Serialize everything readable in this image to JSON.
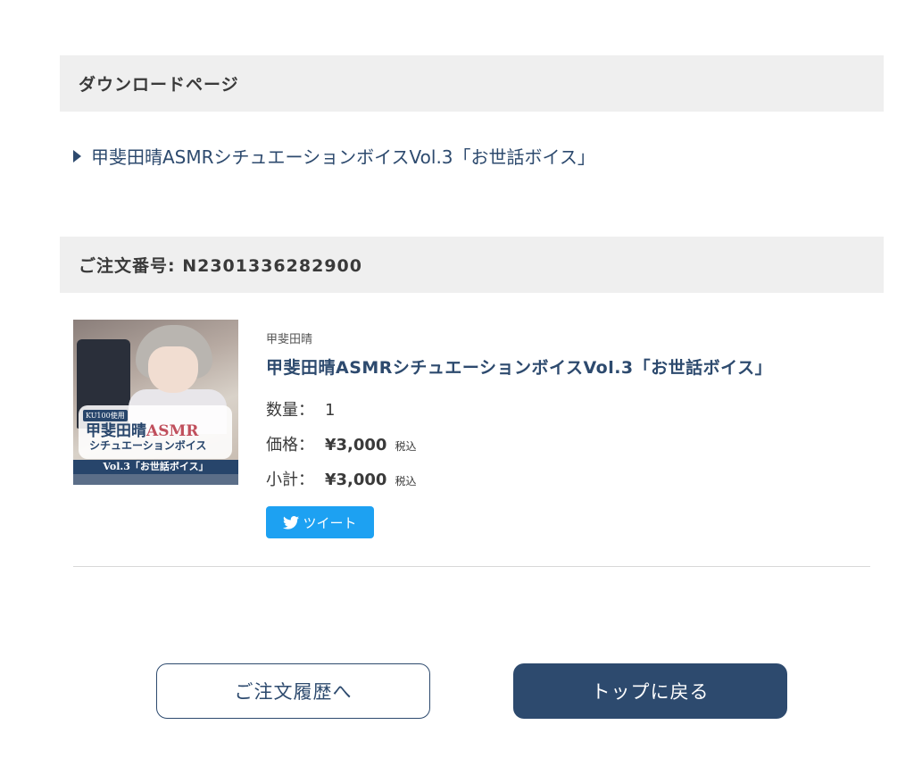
{
  "download_section": {
    "heading": "ダウンロードページ",
    "link_text": "甲斐田晴ASMRシチュエーションボイスVol.3「お世話ボイス」"
  },
  "order_section": {
    "label": "ご注文番号: N2301336282900"
  },
  "product": {
    "maker": "甲斐田晴",
    "title": "甲斐田晴ASMRシチュエーションボイスVol.3「お世話ボイス」",
    "quantity_label": "数量：",
    "quantity_value": "1",
    "price_label": "価格：",
    "price_value": "¥3,000",
    "subtotal_label": "小計：",
    "subtotal_value": "¥3,000",
    "tax_label": "税込",
    "image": {
      "badge": "KU100使用",
      "logo_main_part": "甲斐田晴",
      "logo_asmr": "ASMR",
      "logo_sub": "シチュエーションボイス",
      "logo_vol": "Vol.3「お世話ボイス」"
    }
  },
  "tweet": {
    "label": "ツイート",
    "icon": "twitter-bird-icon",
    "color": "#1da1f2"
  },
  "buttons": {
    "history_label": "ご注文履歴へ",
    "top_label": "トップに戻る"
  },
  "colors": {
    "accent": "#2d4a6e",
    "section_bg": "#efefef"
  }
}
